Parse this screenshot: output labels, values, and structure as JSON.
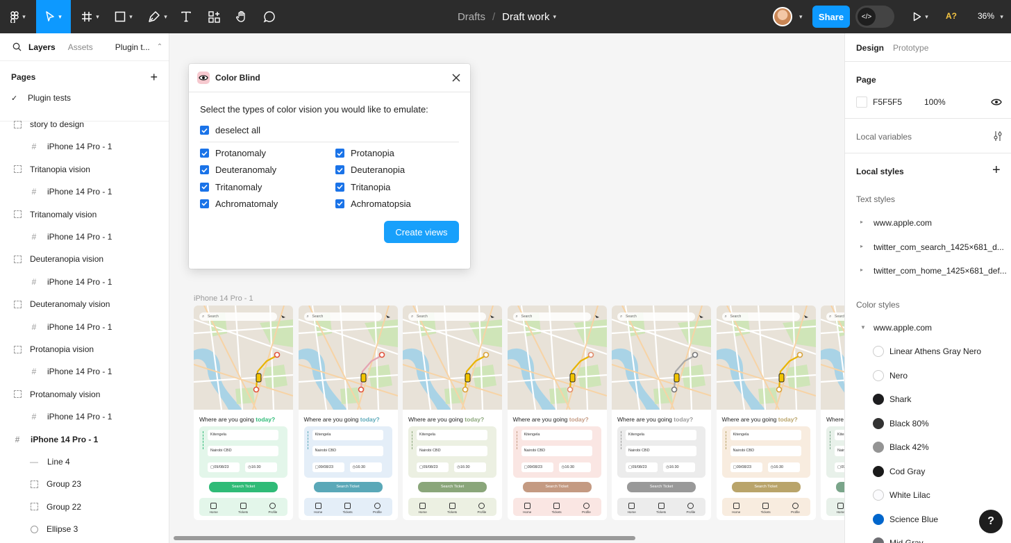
{
  "toolbar": {
    "breadcrumb_parent": "Drafts",
    "breadcrumb_sep": "/",
    "file_name": "Draft work",
    "share_label": "Share",
    "a11y_label": "A?",
    "zoom": "36%",
    "accent": "#0d99ff"
  },
  "left_panel": {
    "tabs": {
      "layers": "Layers",
      "assets": "Assets",
      "plugin": "Plugin t..."
    },
    "pages_title": "Pages",
    "current_page": "Plugin tests",
    "layers": [
      {
        "label": "story to design",
        "icon": "section-icon"
      },
      {
        "label": "iPhone 14 Pro - 1",
        "icon": "frame-icon"
      },
      {
        "label": "Tritanopia vision",
        "icon": "section-icon"
      },
      {
        "label": "iPhone 14 Pro - 1",
        "icon": "frame-icon"
      },
      {
        "label": "Tritanomaly vision",
        "icon": "section-icon"
      },
      {
        "label": "iPhone 14 Pro - 1",
        "icon": "frame-icon"
      },
      {
        "label": "Deuteranopia vision",
        "icon": "section-icon"
      },
      {
        "label": "iPhone 14 Pro - 1",
        "icon": "frame-icon"
      },
      {
        "label": "Deuteranomaly vision",
        "icon": "section-icon"
      },
      {
        "label": "iPhone 14 Pro - 1",
        "icon": "frame-icon"
      },
      {
        "label": "Protanopia vision",
        "icon": "section-icon"
      },
      {
        "label": "iPhone 14 Pro - 1",
        "icon": "frame-icon"
      },
      {
        "label": "Protanomaly vision",
        "icon": "section-icon"
      },
      {
        "label": "iPhone 14 Pro - 1",
        "icon": "frame-icon"
      },
      {
        "label": "iPhone 14 Pro - 1",
        "icon": "frame-icon"
      },
      {
        "label": "Line 4",
        "icon": "line-icon"
      },
      {
        "label": "Group 23",
        "icon": "group-icon"
      },
      {
        "label": "Group 22",
        "icon": "group-icon"
      },
      {
        "label": "Ellipse 3",
        "icon": "ellipse-icon"
      }
    ]
  },
  "dialog": {
    "title": "Color Blind",
    "prompt": "Select the types of color vision you would like to emulate:",
    "deselect_all": "deselect all",
    "options_left": [
      "Protanomaly",
      "Deuteranomaly",
      "Tritanomaly",
      "Achromatomaly"
    ],
    "options_right": [
      "Protanopia",
      "Deuteranopia",
      "Tritanopia",
      "Achromatopsia"
    ],
    "create_label": "Create views"
  },
  "canvas": {
    "frame_label": "iPhone 14 Pro - 1",
    "frame": {
      "search": "Search",
      "question": "Where are you going",
      "question_accent": "today?",
      "from": "Kitengela",
      "to": "Nairobi CBD",
      "date": "09/08/23",
      "time": "16:30",
      "button": "Search Ticket",
      "nav": [
        "Home",
        "Tickets",
        "Profile"
      ]
    },
    "variants": [
      {
        "accent": "#2fbb77",
        "tint": "#e3f6ea",
        "route": "#e8b400",
        "pin": "#e0523c"
      },
      {
        "accent": "#5aa8b8",
        "tint": "#e4eef8",
        "route": "#e5a3b1",
        "pin": "#e0523c"
      },
      {
        "accent": "#8aa67a",
        "tint": "#ecf0e2",
        "route": "#e8b400",
        "pin": "#d8a23a"
      },
      {
        "accent": "#c49a82",
        "tint": "#fae6e3",
        "route": "#e8b400",
        "pin": "#e08a6a"
      },
      {
        "accent": "#999999",
        "tint": "#ececec",
        "route": "#a8a8a8",
        "pin": "#777777"
      },
      {
        "accent": "#b9a46a",
        "tint": "#f8ecdf",
        "route": "#e8b400",
        "pin": "#d7a13a"
      },
      {
        "accent": "#7aa58a",
        "tint": "#e8f1ea",
        "route": "#e8b400",
        "pin": "#e0523c"
      }
    ]
  },
  "right_panel": {
    "tabs": {
      "design": "Design",
      "prototype": "Prototype"
    },
    "page_title": "Page",
    "page_color": "F5F5F5",
    "page_opacity": "100%",
    "local_variables": "Local variables",
    "local_styles": "Local styles",
    "text_styles_title": "Text styles",
    "text_styles": [
      "www.apple.com",
      "twitter_com_search_1425×681_d...",
      "twitter_com_home_1425×681_def..."
    ],
    "color_styles_title": "Color styles",
    "color_group": "www.apple.com",
    "colors": [
      {
        "name": "Linear Athens Gray Nero",
        "hex": "#ffffff"
      },
      {
        "name": "Nero",
        "hex": "#ffffff"
      },
      {
        "name": "Shark",
        "hex": "#1d1d1f"
      },
      {
        "name": "Black 80%",
        "hex": "#333333"
      },
      {
        "name": "Black 42%",
        "hex": "#949494"
      },
      {
        "name": "Cod Gray",
        "hex": "#1a1a1a"
      },
      {
        "name": "White Lilac",
        "hex": "#fbfbfd"
      },
      {
        "name": "Science Blue",
        "hex": "#0066cc"
      },
      {
        "name": "Mid Gray",
        "hex": "#6e6e73"
      }
    ]
  },
  "help_label": "?"
}
